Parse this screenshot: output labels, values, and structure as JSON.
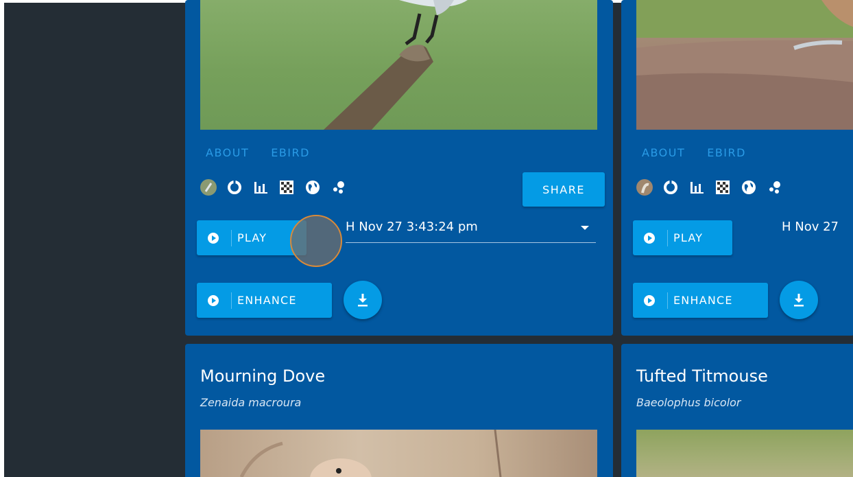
{
  "cards_top": [
    {
      "links": [
        "ABOUT",
        "EBIRD"
      ],
      "share_label": "SHARE",
      "play_label": "PLAY",
      "recording": "H Nov 27 3:43:24 pm",
      "enhance_label": "ENHANCE"
    },
    {
      "links": [
        "ABOUT",
        "EBIRD"
      ],
      "play_label": "PLAY",
      "recording": "H Nov 27",
      "enhance_label": "ENHANCE"
    }
  ],
  "cards_bottom": [
    {
      "common_name": "Mourning Dove",
      "scientific_name": "Zenaida macroura"
    },
    {
      "common_name": "Tufted Titmouse",
      "scientific_name": "Baeolophus bicolor"
    }
  ],
  "colors": {
    "card": "#0258a0",
    "accent": "#049be5",
    "link": "#2a9be6",
    "background": "#242d35"
  },
  "icons": [
    "bird-thumbnail-icon",
    "donut-chart-icon",
    "bar-chart-icon",
    "grid-icon",
    "globe-icon",
    "scatter-icon",
    "download-icon",
    "play-icon"
  ]
}
